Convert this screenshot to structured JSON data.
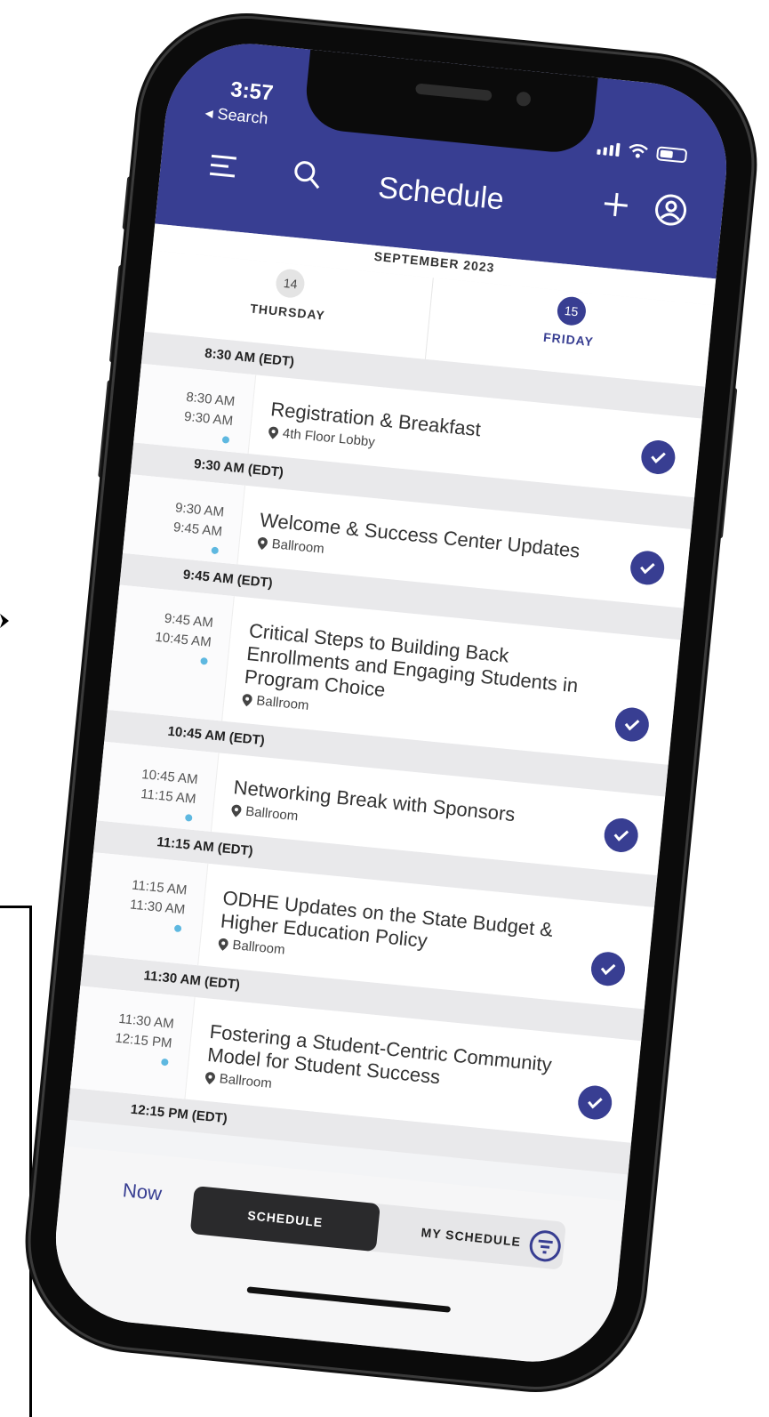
{
  "status_bar": {
    "time": "3:57",
    "back_label": "◂ Search"
  },
  "header": {
    "title": "Schedule"
  },
  "month": "SEPTEMBER 2023",
  "days": [
    {
      "number": "14",
      "name": "THURSDAY",
      "active": false
    },
    {
      "number": "15",
      "name": "FRIDAY",
      "active": true
    }
  ],
  "sessions": [
    {
      "slot": "8:30 AM (EDT)",
      "start": "8:30 AM",
      "end": "9:30 AM",
      "title": "Registration & Breakfast",
      "location": "4th Floor Lobby"
    },
    {
      "slot": "9:30 AM (EDT)",
      "start": "9:30 AM",
      "end": "9:45 AM",
      "title": "Welcome & Success Center Updates",
      "location": "Ballroom"
    },
    {
      "slot": "9:45 AM (EDT)",
      "start": "9:45 AM",
      "end": "10:45 AM",
      "title": "Critical Steps to Building Back Enrollments and Engaging Students in Program Choice",
      "location": "Ballroom"
    },
    {
      "slot": "10:45 AM (EDT)",
      "start": "10:45 AM",
      "end": "11:15 AM",
      "title": "Networking Break with Sponsors",
      "location": "Ballroom"
    },
    {
      "slot": "11:15 AM (EDT)",
      "start": "11:15 AM",
      "end": "11:30 AM",
      "title": "ODHE Updates on the State Budget & Higher Education Policy",
      "location": "Ballroom"
    },
    {
      "slot": "11:30 AM (EDT)",
      "start": "11:30 AM",
      "end": "12:15 PM",
      "title": "Fostering a Student-Centric Community Model for Student Success",
      "location": "Ballroom"
    }
  ],
  "last_slot": "12:15 PM (EDT)",
  "bottom_bar": {
    "now_label": "Now",
    "tab_schedule": "SCHEDULE",
    "tab_my_schedule": "MY SCHEDULE"
  },
  "colors": {
    "primary": "#383e92",
    "dot": "#5eb8e0",
    "active_tab": "#2a2a2c"
  },
  "icons": [
    "menu-icon",
    "search-icon",
    "plus-icon",
    "profile-icon",
    "location-pin-icon",
    "check-icon",
    "filter-icon"
  ]
}
